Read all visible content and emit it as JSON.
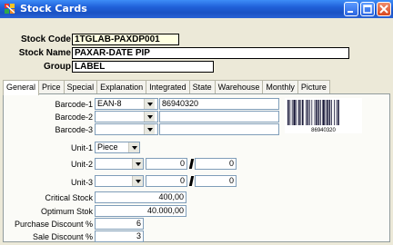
{
  "window": {
    "title": "Stock Cards",
    "icon": "app-multicolor-icon",
    "controls": [
      "minimize-icon",
      "maximize-icon",
      "close-icon"
    ]
  },
  "header": {
    "stock_code_label": "Stock Code",
    "stock_code_value": "1TGLAB-PAXDP001",
    "stock_name_label": "Stock Name",
    "stock_name_value": "PAXAR-DATE PIP",
    "group_label": "Group",
    "group_value": "LABEL"
  },
  "tabs": [
    {
      "label": "General",
      "active": true
    },
    {
      "label": "Price"
    },
    {
      "label": "Special"
    },
    {
      "label": "Explanation"
    },
    {
      "label": "Integrated"
    },
    {
      "label": "State"
    },
    {
      "label": "Warehouse"
    },
    {
      "label": "Monthly"
    },
    {
      "label": "Picture"
    }
  ],
  "general": {
    "barcode1_label": "Barcode-1",
    "barcode1_type": "EAN-8",
    "barcode1_value": "86940320",
    "barcode2_label": "Barcode-2",
    "barcode2_type": "",
    "barcode2_value": "",
    "barcode3_label": "Barcode-3",
    "barcode3_type": "",
    "barcode3_value": "",
    "barcode_image_text": "86940320",
    "unit1_label": "Unit-1",
    "unit1_value": "Piece",
    "unit2_label": "Unit-2",
    "unit2_value": "",
    "unit2_num1": "0",
    "unit2_num2": "0",
    "unit3_label": "Unit-3",
    "unit3_value": "",
    "unit3_num1": "0",
    "unit3_num2": "0",
    "critical_stock_label": "Critical Stock",
    "critical_stock_value": "400,00",
    "optimum_stok_label": "Optimum Stok",
    "optimum_stok_value": "40.000,00",
    "purchase_discount_label": "Purchase Discount %",
    "purchase_discount_value": "6",
    "sale_discount_label": "Sale Discount %",
    "sale_discount_value": "3"
  },
  "colors": {
    "titlebar": "#1f5fd8",
    "window_bg": "#ece9d8",
    "highlight_field": "#ffffe1"
  }
}
